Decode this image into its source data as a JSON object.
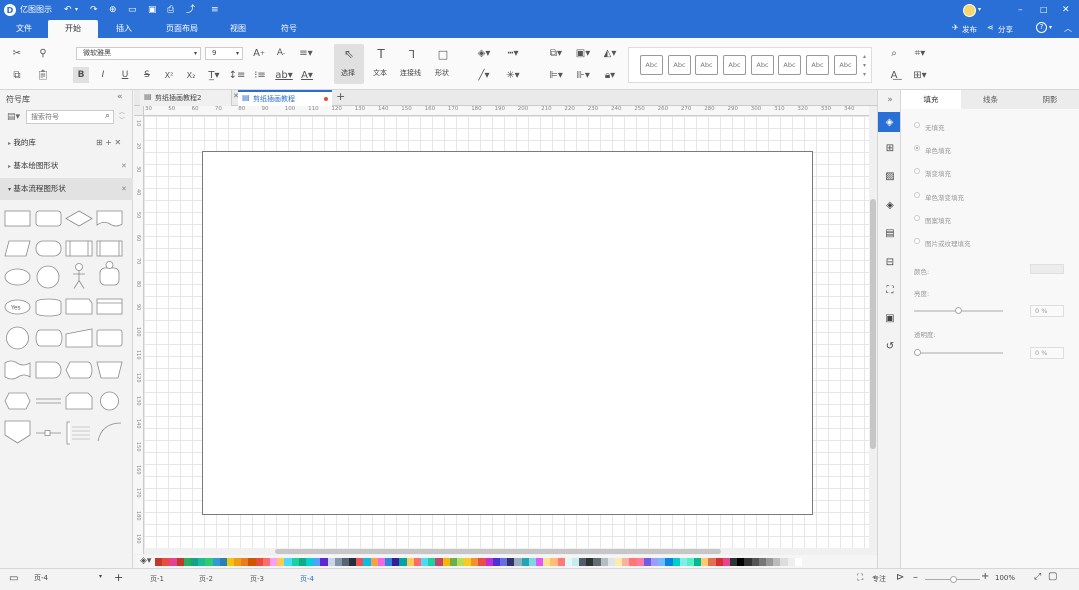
{
  "app": {
    "title": "亿图图示"
  },
  "titlebar": {
    "publish": "发布",
    "share": "分享",
    "help": "?"
  },
  "menu": {
    "items": [
      {
        "label": "文件"
      },
      {
        "label": "开始"
      },
      {
        "label": "插入"
      },
      {
        "label": "页面布局"
      },
      {
        "label": "视图"
      },
      {
        "label": "符号"
      }
    ],
    "active_index": 1
  },
  "ribbon": {
    "font_name": "微软雅黑",
    "font_size": "9",
    "select_label": "选择",
    "text_label": "文本",
    "connector_label": "连接线",
    "shape_label": "形状",
    "bold": "B",
    "italic": "I",
    "underline": "U",
    "strike": "S",
    "superscript": "X²",
    "subscript": "X₂",
    "styles": [
      "Abc",
      "Abc",
      "Abc",
      "Abc",
      "Abc",
      "Abc",
      "Abc",
      "Abc"
    ]
  },
  "library": {
    "title": "符号库",
    "search_placeholder": "搜索符号",
    "my_library": "我的库",
    "basic_shapes": "基本绘图形状",
    "flowchart_shapes": "基本流程图形状",
    "yes_label": "Yes"
  },
  "tabs": [
    {
      "label": "剪纸插画教程2"
    },
    {
      "label": "剪纸插画教程"
    }
  ],
  "ruler": {
    "h_ticks": [
      "30",
      "50",
      "60",
      "70",
      "80",
      "90",
      "100",
      "110",
      "120",
      "130",
      "140",
      "150",
      "160",
      "170",
      "180",
      "190",
      "200",
      "210",
      "220",
      "230",
      "240",
      "250",
      "260",
      "270",
      "280",
      "290",
      "300",
      "310",
      "320",
      "330",
      "340"
    ],
    "v_ticks": [
      "10",
      "20",
      "30",
      "40",
      "50",
      "60",
      "70",
      "80",
      "90",
      "100",
      "110",
      "120",
      "130",
      "140",
      "150",
      "160",
      "170",
      "180",
      "190"
    ]
  },
  "rightpanel": {
    "tabs": [
      "填充",
      "线条",
      "阴影"
    ],
    "fill_options": [
      "无填充",
      "单色填充",
      "渐变填充",
      "单色渐变填充",
      "图案填充",
      "图片或纹理填充"
    ],
    "color_label": "颜色:",
    "brightness_label": "亮度:",
    "brightness_value": "0 %",
    "transparency_label": "透明度:",
    "transparency_value": "0 %"
  },
  "status": {
    "page_select": "页-4",
    "pages": [
      "页-1",
      "页-2",
      "页-3",
      "页-4"
    ],
    "active_page": 3,
    "focus_label": "专注",
    "zoom": "100%"
  },
  "palette": [
    "#c0392b",
    "#e74c3c",
    "#e84393",
    "#c0392b",
    "#27ae60",
    "#16a085",
    "#1abc9c",
    "#2ecc71",
    "#3498db",
    "#2980b9",
    "#f1c40f",
    "#f39c12",
    "#e67e22",
    "#d35400",
    "#e74c3c",
    "#ff6b6b",
    "#ff9ff3",
    "#feca57",
    "#48dbfb",
    "#1dd1a1",
    "#10ac84",
    "#00d2d3",
    "#54a0ff",
    "#5f27cd",
    "#c8d6e5",
    "#8395a7",
    "#576574",
    "#222f3e",
    "#ee5253",
    "#0abde3",
    "#ff9f43",
    "#f368e0",
    "#2e86de",
    "#341f97",
    "#01a3a4",
    "#feca57",
    "#ff6b6b",
    "#48dbfb",
    "#1dd1a1",
    "#c44569",
    "#f8b500",
    "#6ab04c",
    "#badc58",
    "#f9ca24",
    "#f0932b",
    "#eb4d4b",
    "#be2edd",
    "#4834d4",
    "#686de0",
    "#30336b",
    "#95afc0",
    "#22a6b3",
    "#7ed6df",
    "#e056fd",
    "#f6e58d",
    "#ffbe76",
    "#ff7979",
    "#dff9fb",
    "#c7ecee",
    "#535c68",
    "#2d3436",
    "#636e72",
    "#b2bec3",
    "#dfe6e9",
    "#ffeaa7",
    "#fab1a0",
    "#ff7675",
    "#fd79a8",
    "#6c5ce7",
    "#a29bfe",
    "#74b9ff",
    "#0984e3",
    "#00cec9",
    "#81ecec",
    "#55efc4",
    "#00b894",
    "#fdcb6e",
    "#e17055",
    "#d63031",
    "#e84393",
    "#2d3436",
    "#000000",
    "#333333",
    "#555555",
    "#777777",
    "#999999",
    "#bbbbbb",
    "#dddddd",
    "#eeeeee",
    "#ffffff"
  ]
}
